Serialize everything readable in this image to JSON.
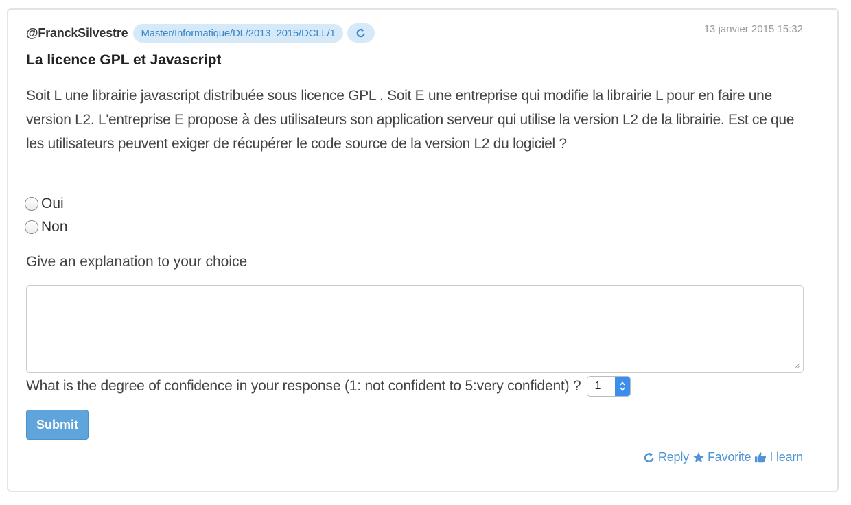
{
  "post": {
    "author": "@FranckSilvestre",
    "tag": "Master/Informatique/DL/2013_2015/DCLL/1",
    "share_icon": "share-icon",
    "date": "13 janvier 2015 15:32",
    "title": "La licence GPL et Javascript",
    "question": "Soit L une librairie javascript distribuée sous licence GPL . Soit E une entreprise qui modifie la librairie L pour en faire une version L2. L'entreprise E propose à des utilisateurs son application serveur qui utilise la version L2 de la librairie. Est ce que les utilisateurs peuvent exiger de récupérer le code source de la version L2 du logiciel ?"
  },
  "options": [
    {
      "label": "Oui",
      "selected": false
    },
    {
      "label": "Non",
      "selected": false
    }
  ],
  "explanation": {
    "label": "Give an explanation to your choice",
    "value": ""
  },
  "confidence": {
    "label": "What is the degree of confidence in your response (1: not confident to 5:very confident) ?",
    "selected_value": "1"
  },
  "submit_label": "Submit",
  "actions": {
    "reply": "Reply",
    "favorite": "Favorite",
    "learn": "I learn"
  },
  "colors": {
    "accent": "#5fa5dc",
    "link": "#4f94d4",
    "tag_bg": "#d6e9f8"
  }
}
